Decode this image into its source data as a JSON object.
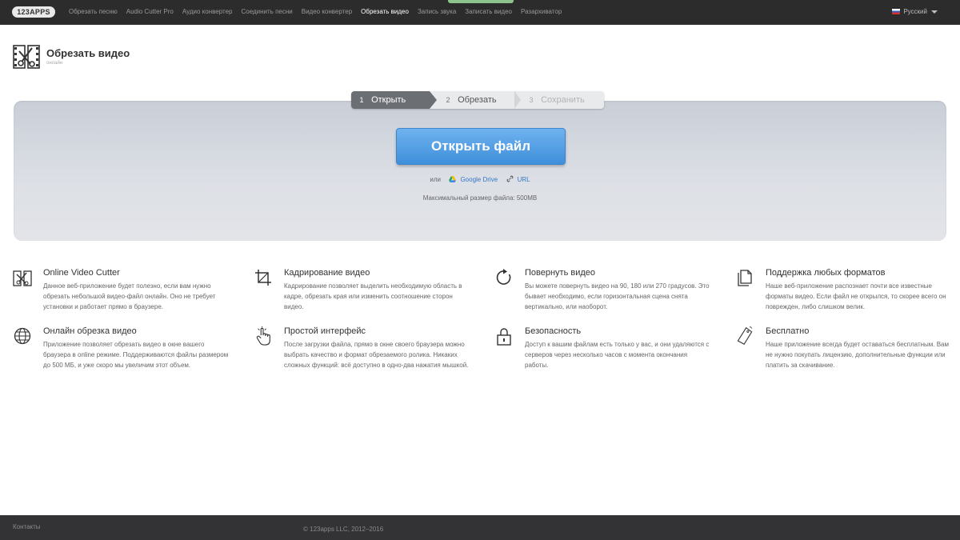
{
  "nav": {
    "logo": "123APPS",
    "items": [
      "Обрезать песню",
      "Audio Cutter Pro",
      "Аудио конвертер",
      "Соединить песни",
      "Видео конвертер",
      "Обрезать видео",
      "Запись звука",
      "Записать видео",
      "Разархиватор"
    ],
    "active_index": 5,
    "language": "Русский"
  },
  "header": {
    "title": "Обрезать видео",
    "subtitle": "онлайн"
  },
  "steps": [
    {
      "num": "1",
      "label": "Открыть"
    },
    {
      "num": "2",
      "label": "Обрезать"
    },
    {
      "num": "3",
      "label": "Сохранить"
    }
  ],
  "upload": {
    "button_label": "Открыть файл",
    "or_text": "или",
    "google_drive": "Google Drive",
    "url": "URL",
    "max_size": "Максимальный размер файла: 500MB"
  },
  "features": [
    {
      "icon": "video-cutter-icon",
      "title": "Online Video Cutter",
      "text": "Данное веб-приложение будет полезно, если вам нужно обрезать небольшой видео-файл онлайн. Оно не требует установки и работает прямо в браузере."
    },
    {
      "icon": "crop-icon",
      "title": "Кадрирование видео",
      "text": "Кадрирование позволяет выделить необходимую область в кадре, обрезать края или изменить соотношение сторон видео."
    },
    {
      "icon": "rotate-icon",
      "title": "Повернуть видео",
      "text": "Вы можете повернуть видео на 90, 180 или 270 градусов. Это бывает необходимо, если горизонтальная сцена снята вертикально, или наоборот."
    },
    {
      "icon": "formats-icon",
      "title": "Поддержка любых форматов",
      "text": "Наше веб-приложение распознает почти все известные форматы видео. Если файл не открылся, то скорее всего он поврежден, либо слишком велик."
    },
    {
      "icon": "globe-icon",
      "title": "Онлайн обрезка видео",
      "text": "Приложение позволяет обрезать видео в окне вашего браузера в online режиме. Поддерживаются файлы размером до 500 МБ, и уже скоро мы увеличим этот объем."
    },
    {
      "icon": "pointer-hand-icon",
      "title": "Простой интерфейс",
      "text": "После загрузки файла, прямо в окне своего браузера можно выбрать качество и формат обрезаемого ролика. Никаких сложных функций: всё доступно в одно-два нажатия мышкой."
    },
    {
      "icon": "lock-icon",
      "title": "Безопасность",
      "text": "Доступ к вашим файлам есть только у вас, и они удаляются с серверов через несколько часов с момента окончания работы."
    },
    {
      "icon": "free-tag-icon",
      "title": "Бесплатно",
      "text": "Наше приложение всегда будет оставаться бесплатным. Вам не нужно покупать лицензию, дополнительные функции или платить за скачивание."
    }
  ],
  "footer": {
    "contacts": "Контакты",
    "copyright": "© 123apps LLC, 2012–2016"
  }
}
